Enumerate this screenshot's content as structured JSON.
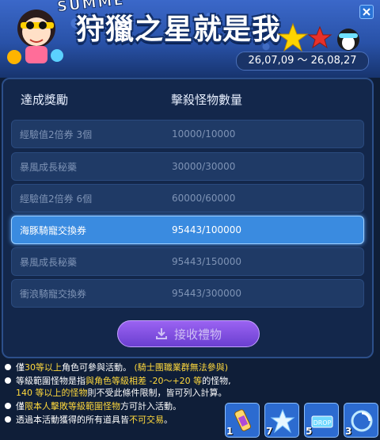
{
  "banner": {
    "summer_text": "SUMME",
    "title": "狩獵之星就是我",
    "date_range": "26,07,09 ～ 26,08,27"
  },
  "table": {
    "headers": [
      "達成獎勵",
      "擊殺怪物數量"
    ],
    "rows": [
      {
        "reward": "經驗值2倍券 3個",
        "progress": "10000/10000",
        "state": "done"
      },
      {
        "reward": "暴風成長秘藥",
        "progress": "30000/30000",
        "state": "done"
      },
      {
        "reward": "經驗值2倍券 6個",
        "progress": "60000/60000",
        "state": "done"
      },
      {
        "reward": "海豚騎寵交換券",
        "progress": "95443/100000",
        "state": "selected"
      },
      {
        "reward": "暴風成長秘藥",
        "progress": "95443/150000",
        "state": "locked"
      },
      {
        "reward": "衝浪騎寵交換券",
        "progress": "95443/300000",
        "state": "locked"
      }
    ]
  },
  "claim_button": {
    "label": "接收禮物"
  },
  "notes": [
    {
      "parts": [
        "僅",
        "30等以上",
        "角色可參與活動。 ",
        "(騎士團職業群無法參與)"
      ]
    },
    {
      "parts": [
        "等級範圍怪物是指",
        "與角色等級相差 -20～+20 等",
        "的怪物,",
        "140 等以上的怪物",
        "則不受此條件限制，皆可列入計算。"
      ]
    },
    {
      "parts": [
        "僅",
        "限本人擊敗等級範圍怪物",
        "方可計入活動。"
      ]
    },
    {
      "parts": [
        "透過本活動獲得的所有道具皆",
        "不可交易",
        "。"
      ]
    }
  ],
  "quickslots": [
    {
      "key": "1",
      "icon": "potion-scroll-icon"
    },
    {
      "key": "7",
      "icon": "ice-shard-icon"
    },
    {
      "key": "5",
      "icon": "drop-icon"
    },
    {
      "key": "3",
      "icon": "spiral-icon"
    }
  ],
  "colors": {
    "accent": "#3a8be0",
    "highlight_text": "#ffd93d",
    "button": "#7a4fe0"
  }
}
